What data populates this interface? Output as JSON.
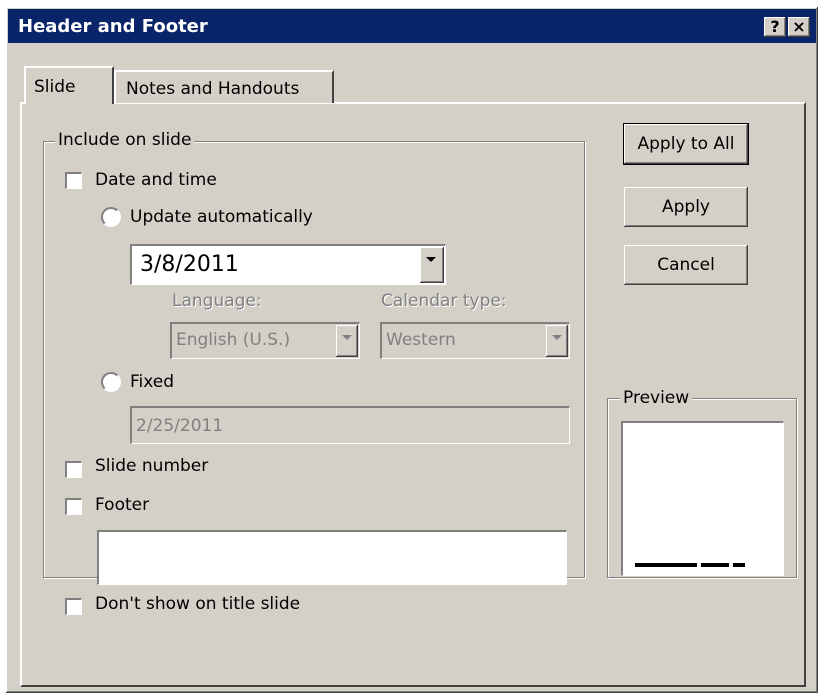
{
  "window": {
    "title": "Header and Footer",
    "help_label": "?",
    "close_label": "×"
  },
  "tabs": [
    {
      "label": "Slide",
      "active": true
    },
    {
      "label": "Notes and Handouts",
      "active": false
    }
  ],
  "include_group": {
    "legend": "Include on slide",
    "date_time": {
      "label": "Date and time",
      "checked": false,
      "update_auto": {
        "label": "Update automatically",
        "selected": false,
        "value": "3/8/2011"
      },
      "language": {
        "label": "Language:",
        "value": "English (U.S.)",
        "enabled": false
      },
      "calendar": {
        "label": "Calendar type:",
        "value": "Western",
        "enabled": false
      },
      "fixed": {
        "label": "Fixed",
        "selected": false,
        "value": "2/25/2011"
      }
    },
    "slide_number": {
      "label": "Slide number",
      "checked": false
    },
    "footer": {
      "label": "Footer",
      "checked": false,
      "value": ""
    }
  },
  "dont_show_title": {
    "label": "Don't show on title slide",
    "checked": false
  },
  "buttons": {
    "apply_all": "Apply to All",
    "apply": "Apply",
    "cancel": "Cancel"
  },
  "preview": {
    "legend": "Preview"
  }
}
